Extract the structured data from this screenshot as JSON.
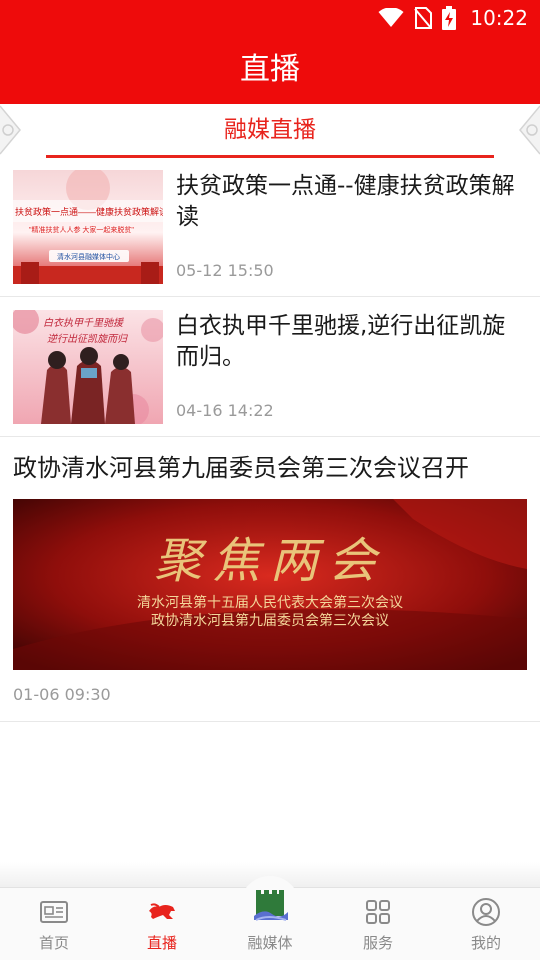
{
  "status_bar": {
    "time": "10:22",
    "icons": [
      "wifi-icon",
      "no-sim-icon",
      "battery-charging-icon"
    ]
  },
  "header": {
    "title": "直播"
  },
  "section": {
    "title": "融媒直播"
  },
  "news": [
    {
      "title": "扶贫政策一点通--健康扶贫政策解读",
      "time": "05-12 15:50",
      "thumbnail_text": [
        "扶贫政策一点通——健康扶贫政策解读",
        "\"精准扶贫人人参 大家一起来脱贫\"",
        "清水河县融媒体中心"
      ]
    },
    {
      "title": "白衣执甲千里驰援,逆行出征凯旋而归。",
      "time": "04-16 14:22",
      "thumbnail_text": [
        "白衣执甲千里驰援",
        "逆行出征凯旋而归"
      ]
    }
  ],
  "featured": {
    "title": "政协清水河县第九届委员会第三次会议召开",
    "time": "01-06 09:30",
    "banner_text": [
      "聚焦两会",
      "清水河县第十五届人民代表大会第三次会议",
      "政协清水河县第九届委员会第三次会议"
    ]
  },
  "bottom_nav": {
    "items": [
      {
        "label": "首页",
        "icon": "news-icon",
        "active": false
      },
      {
        "label": "直播",
        "icon": "horse-icon",
        "active": true
      },
      {
        "label": "融媒体",
        "icon": "media-logo-icon",
        "active": false
      },
      {
        "label": "服务",
        "icon": "grid-icon",
        "active": false
      },
      {
        "label": "我的",
        "icon": "user-icon",
        "active": false
      }
    ]
  },
  "colors": {
    "brand_red": "#ee0b0b",
    "accent_red": "#e8241d",
    "text_gray": "#9a9a9a"
  }
}
